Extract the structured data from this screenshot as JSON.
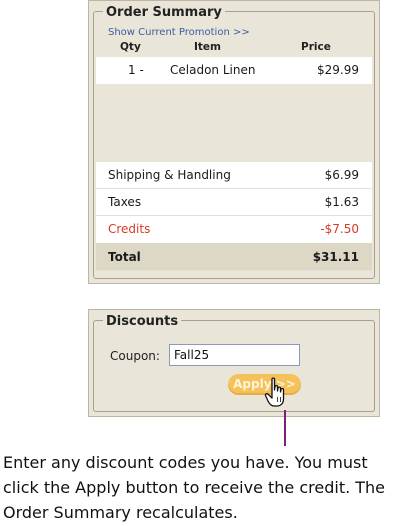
{
  "order_summary": {
    "title": "Order Summary",
    "promo_link": "Show Current Promotion >>",
    "columns": {
      "qty": "Qty",
      "item": "Item",
      "price": "Price"
    },
    "items": [
      {
        "qty": "1 -",
        "name": "Celadon Linen",
        "price": "$29.99"
      }
    ],
    "shipping": {
      "label": "Shipping & Handling",
      "value": "$6.99"
    },
    "taxes": {
      "label": "Taxes",
      "value": "$1.63"
    },
    "credits": {
      "label": "Credits",
      "value": "-$7.50",
      "color": "#d83a2a"
    },
    "total": {
      "label": "Total",
      "value": "$31.11"
    }
  },
  "discounts": {
    "title": "Discounts",
    "coupon_label": "Coupon:",
    "coupon_value": "Fall25",
    "apply_label": "Apply >>",
    "apply_color": "#f5c15a"
  },
  "cursor_icon": "hand-pointer-icon",
  "caption": "Enter any discount codes you have. You must click the Apply button to receive the credit. The Order Summary recalculates."
}
